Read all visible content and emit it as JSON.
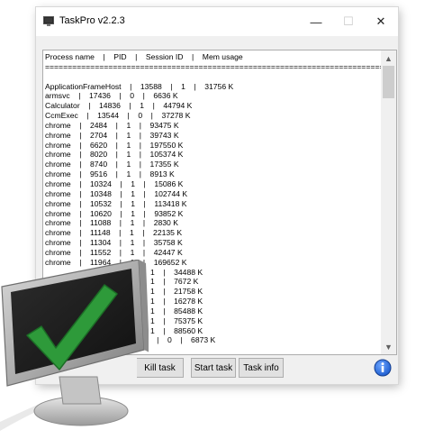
{
  "window": {
    "title": "TaskPro v2.2.3",
    "controls": {
      "minimize": "—",
      "maximize": "☐",
      "close": "✕"
    }
  },
  "process_list": {
    "lines": [
      "Process name    |    PID    |    Session ID    |    Mem usage",
      "================================================================================",
      "",
      "ApplicationFrameHost    |    13588    |    1    |    31756 K",
      "armsvc    |    17436    |    0    |    6636 K",
      "Calculator    |    14836    |    1    |    44794 K",
      "CcmExec    |    13544    |    0    |    37278 K",
      "chrome    |    2484    |    1    |    93475 K",
      "chrome    |    2704    |    1    |    39743 K",
      "chrome    |    6620    |    1    |    197550 K",
      "chrome    |    8020    |    1    |    105374 K",
      "chrome    |    8740    |    1    |    17355 K",
      "chrome    |    9516    |    1    |    8913 K",
      "chrome    |    10324    |    1    |    15086 K",
      "chrome    |    10348    |    1    |    102744 K",
      "chrome    |    10532    |    1    |    113418 K",
      "chrome    |    10620    |    1    |    93852 K",
      "chrome    |    11088    |    1    |    2830 K",
      "chrome    |    11148    |    1    |    22135 K",
      "chrome    |    11304    |    1    |    35758 K",
      "chrome    |    11552    |    1    |    42447 K",
      "chrome    |    11964    |    1    |    169652 K",
      "                                                 1    |    34488 K",
      "                                                 1    |    7672 K",
      "                                                 1    |    21758 K",
      "                                                 1    |    16278 K",
      "                                                 1    |    85488 K",
      "                                                 1    |    75375 K",
      "                                                 1    |    88560 K",
      "                                                    |    0    |    6873 K"
    ]
  },
  "buttons": {
    "kill_task": "Kill task",
    "start_task": "Start task",
    "task_info": "Task info",
    "info_icon": "info-icon"
  },
  "colors": {
    "checkmark": "#2e9a3a",
    "info_blue": "#1f5fd1"
  }
}
